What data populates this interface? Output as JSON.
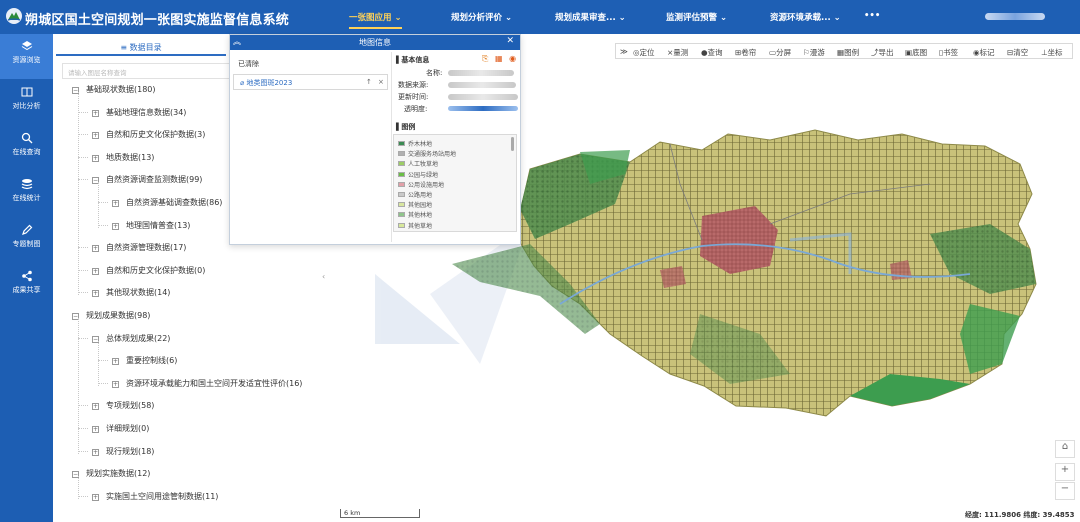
{
  "header": {
    "title": "朔城区国土空间规划一张图实施监督信息系统",
    "nav": [
      "一张图应用",
      "规划分析评价",
      "规划成果审查...",
      "监测评估预警",
      "资源环境承载...",
      "•••"
    ]
  },
  "sidebar": {
    "items": [
      {
        "label": "资源浏览",
        "icon": "layers-icon",
        "active": true
      },
      {
        "label": "对比分析",
        "icon": "compare-icon"
      },
      {
        "label": "在线查询",
        "icon": "search-icon"
      },
      {
        "label": "在线统计",
        "icon": "stack-icon"
      },
      {
        "label": "专题制图",
        "icon": "pen-icon"
      },
      {
        "label": "成果共享",
        "icon": "share-icon"
      }
    ]
  },
  "catalog": {
    "tab": "数据目录",
    "search_placeholder": "请输入图层名称查询",
    "tree": [
      {
        "label": "基础现状数据(180)",
        "level": 0,
        "open": true
      },
      {
        "label": "基础地理信息数据(34)",
        "level": 1
      },
      {
        "label": "自然和历史文化保护数据(3)",
        "level": 1
      },
      {
        "label": "地质数据(13)",
        "level": 1
      },
      {
        "label": "自然资源调查监测数据(99)",
        "level": 1,
        "open": true
      },
      {
        "label": "自然资源基础调查数据(86)",
        "level": 2
      },
      {
        "label": "地理国情普查(13)",
        "level": 2
      },
      {
        "label": "自然资源管理数据(17)",
        "level": 1
      },
      {
        "label": "自然和历史文化保护数据(0)",
        "level": 1
      },
      {
        "label": "其他现状数据(14)",
        "level": 1
      },
      {
        "label": "规划成果数据(98)",
        "level": 0,
        "open": true
      },
      {
        "label": "总体规划成果(22)",
        "level": 1,
        "open": true
      },
      {
        "label": "重要控制线(6)",
        "level": 2
      },
      {
        "label": "资源环境承载能力和国土空间开发适宜性评价(16)",
        "level": 2
      },
      {
        "label": "专项规划(58)",
        "level": 1
      },
      {
        "label": "详细规划(0)",
        "level": 1
      },
      {
        "label": "现行规划(18)",
        "level": 1
      },
      {
        "label": "规划实施数据(12)",
        "level": 0,
        "open": true
      },
      {
        "label": "实施国土空间用途管制数据(11)",
        "level": 1
      }
    ]
  },
  "map_info": {
    "title": "地图信息",
    "clear_label": "已清除",
    "layer_name": "地类图斑2023",
    "basic_info_label": "基本信息",
    "fields": [
      "名称:",
      "数据来源:",
      "更新时间:",
      "透明度:"
    ],
    "legend_label": "图例",
    "legend": [
      {
        "label": "乔木林地",
        "color": "#3a8a52"
      },
      {
        "label": "交通服务场站用地",
        "color": "#b0b0b0"
      },
      {
        "label": "人工牧草地",
        "color": "#9ccc65"
      },
      {
        "label": "公园与绿地",
        "color": "#6abe45"
      },
      {
        "label": "公用设施用地",
        "color": "#e2a0a8"
      },
      {
        "label": "公路用地",
        "color": "#c9c9c9"
      },
      {
        "label": "其他园地",
        "color": "#d8e6a0"
      },
      {
        "label": "其他林地",
        "color": "#8fc48b"
      },
      {
        "label": "其他草地",
        "color": "#d7e89b"
      }
    ]
  },
  "toolbar": [
    "定位",
    "量测",
    "查询",
    "卷帘",
    "分屏",
    "漫游",
    "图例",
    "导出",
    "底图",
    "书签",
    "标记",
    "清空",
    "坐标"
  ],
  "map": {
    "scale": "6 km",
    "coords": "经度: 111.9806 纬度: 39.4853"
  }
}
